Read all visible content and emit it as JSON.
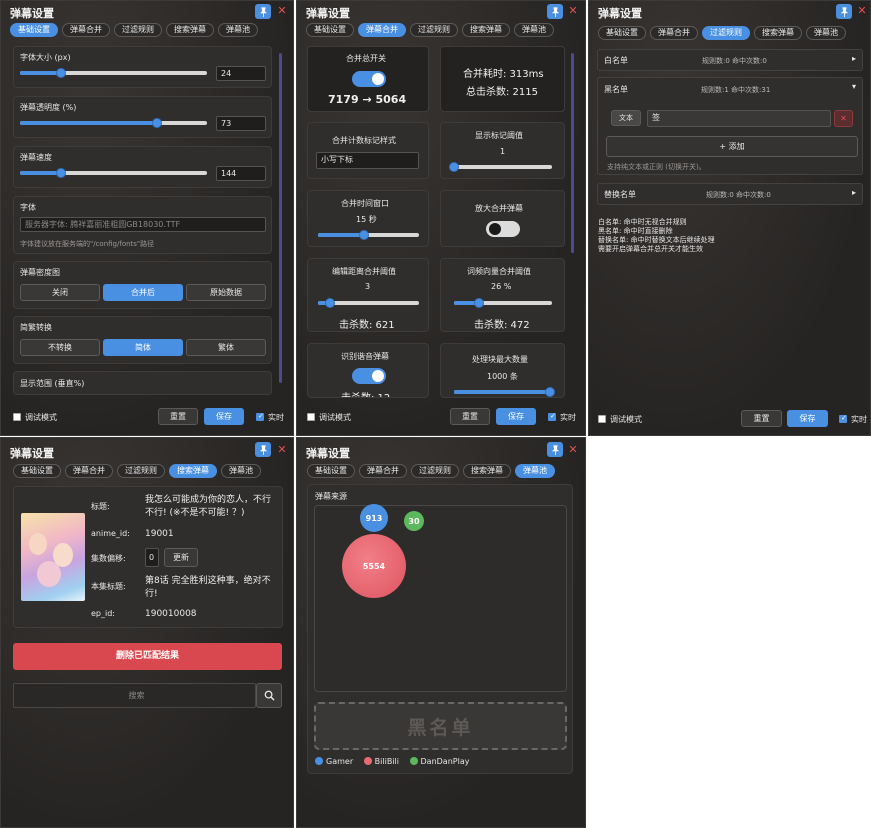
{
  "window_title": "弹幕设置",
  "tabs": [
    "基础设置",
    "弹幕合并",
    "过滤规则",
    "搜索弹幕",
    "弹幕池"
  ],
  "footer": {
    "debug": "调试模式",
    "reset": "重置",
    "save": "保存",
    "realtime": "实时"
  },
  "basic": {
    "font_size_label": "字体大小 (px)",
    "font_size": "24",
    "font_size_pct": 0.22,
    "opacity_label": "弹幕透明度 (%)",
    "opacity": "73",
    "opacity_pct": 0.73,
    "speed_label": "弹幕速度",
    "speed": "144",
    "speed_pct": 0.22,
    "font_label": "字体",
    "font_placeholder": "服务器字体: 腾祥嘉丽准粗圆GB18030.TTF",
    "font_hint": "字体建议放在服务端的\"/config/fonts\"路径",
    "density_label": "弹幕密度图",
    "density_options": [
      "关闭",
      "合并后",
      "原始数据"
    ],
    "convert_label": "简繁转换",
    "convert_options": [
      "不转换",
      "简体",
      "繁体"
    ],
    "range_label": "显示范围 (垂直%)"
  },
  "merge": {
    "master_label": "合并总开关",
    "before_after": "7179 → 5064",
    "time_cost": "合并耗时: 313ms",
    "total_kills": "总击杀数: 2115",
    "mark_style_label": "合并计数标记样式",
    "mark_style_value": "小写下标",
    "mark_threshold_label": "显示标记阈值",
    "mark_threshold": "1",
    "mark_threshold_pct": 0.0,
    "window_label": "合并时间窗口",
    "window_value": "15 秒",
    "window_pct": 0.46,
    "enlarge_label": "放大合并弹幕",
    "edit_label": "编辑距离合并阈值",
    "edit_value": "3",
    "edit_pct": 0.12,
    "edit_kills": "击杀数: 621",
    "vector_label": "词频向量合并阈值",
    "vector_value": "26 %",
    "vector_pct": 0.26,
    "vector_kills": "击杀数: 472",
    "pinyin_label": "识别谐音弹幕",
    "pinyin_kills": "击杀数: 12",
    "chunk_label": "处理块最大数量",
    "chunk_value": "1000 条",
    "chunk_pct": 0.98
  },
  "filter": {
    "whitelist": "白名单",
    "whitelist_stat": "规则数:0  命中次数:0",
    "blacklist": "黑名单",
    "blacklist_stat": "规则数:1  命中次数:31",
    "rule_type": "文本",
    "rule_value": "签",
    "add": "+ 添加",
    "rule_hint": "支持纯文本或正则 (切换开关)。",
    "replace": "替换名单",
    "replace_stat": "规则数:0  命中次数:0",
    "notes": [
      "白名单: 命中时无视合并规则",
      "黑名单: 命中时直接删除",
      "替换名单: 命中时替换文本后继续处理",
      "需要开启弹幕合并总开关才能生效"
    ]
  },
  "search": {
    "title_label": "标题:",
    "title_value": "我怎么可能成为你的恋人，不行不行! (※不是不可能! ？)",
    "anime_label": "anime_id:",
    "anime_value": "19001",
    "offset_label": "集数偏移:",
    "offset_value": "0",
    "update": "更新",
    "ep_title_label": "本集标题:",
    "ep_title_value": "第8话 完全胜利这种事，绝对不行!",
    "ep_label": "ep_id:",
    "ep_value": "190010008",
    "delete": "删除已匹配结果",
    "search_placeholder": "搜索"
  },
  "pool": {
    "source_label": "弹幕来源",
    "blacklist_zone": "黑名单",
    "bubbles": [
      {
        "source": "Gamer",
        "value": "913",
        "color": "#4a90e2"
      },
      {
        "source": "BiliBili",
        "value": "5554",
        "color": "#e86a74"
      },
      {
        "source": "DanDanPlay",
        "value": "30",
        "color": "#5cb85c"
      }
    ],
    "legend": [
      "Gamer",
      "BiliBili",
      "DanDanPlay"
    ]
  },
  "colors": {
    "accent": "#4a90e2",
    "danger": "#d9484f",
    "panel": "#2a2827"
  }
}
